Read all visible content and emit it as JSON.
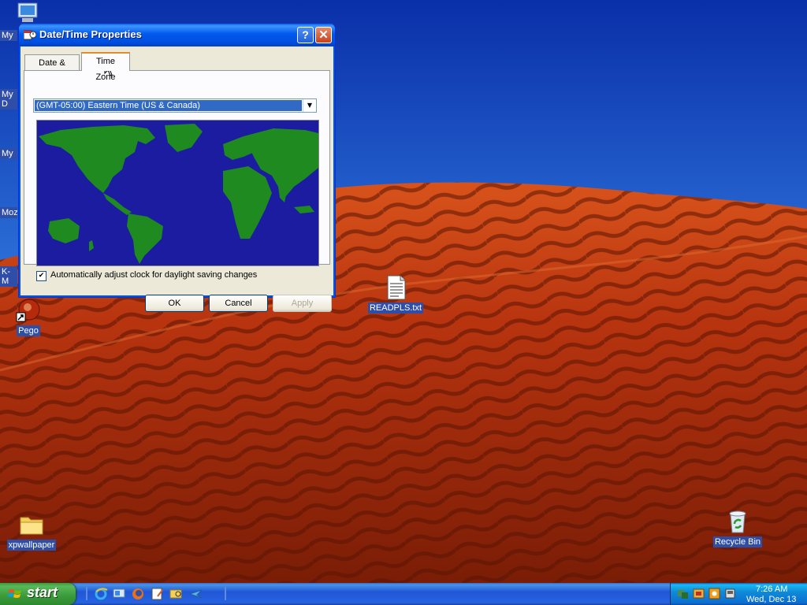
{
  "window": {
    "title": "Date/Time Properties",
    "help_label": "?",
    "close_label": "✕",
    "tabs": [
      {
        "label": "Date & Time"
      },
      {
        "label": "Time Zone"
      }
    ],
    "timezone_select": {
      "value": "(GMT-05:00) Eastern Time (US & Canada)"
    },
    "dst_checkbox": {
      "label": "Automatically adjust clock for daylight saving changes",
      "checked": true,
      "mark": "✔"
    },
    "buttons": {
      "ok": "OK",
      "cancel": "Cancel",
      "apply": "Apply"
    }
  },
  "desktop": {
    "edge_labels": [
      "My",
      "My D",
      "My",
      "Moz",
      "K-M"
    ],
    "icons": {
      "pego": "Pego",
      "readme": "READPLS.txt",
      "xpwallpaper": "xpwallpaper",
      "recycle": "Recycle Bin"
    }
  },
  "taskbar": {
    "start_label": "start",
    "clock": {
      "time": "7:26 AM",
      "date": "Wed, Dec 13"
    }
  },
  "colors": {
    "titlebar": "#0058ee",
    "window_bg": "#ece9d8",
    "selection": "#316ac5",
    "map_ocean": "#1c1ca0",
    "map_land": "#1f8a1f",
    "taskbar": "#2157d7",
    "start_green": "#3a9a3a"
  }
}
